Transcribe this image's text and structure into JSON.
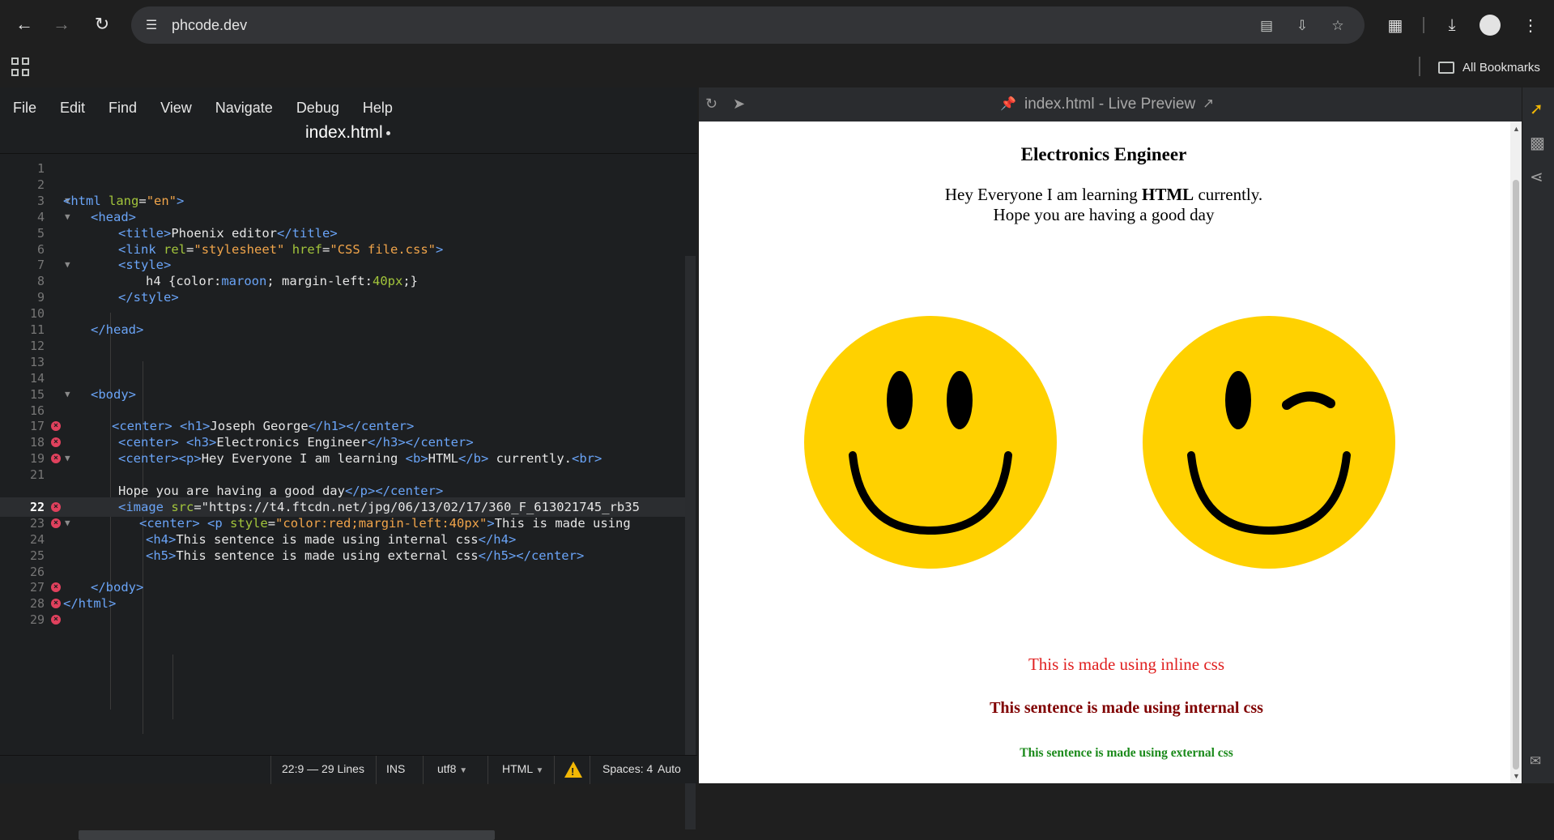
{
  "browser": {
    "url": "phcode.dev",
    "bookmarks_label": "All Bookmarks"
  },
  "editor": {
    "menu": [
      "File",
      "Edit",
      "Find",
      "View",
      "Navigate",
      "Debug",
      "Help"
    ],
    "file_title": "index.html",
    "lines": [
      {
        "n": "1",
        "text": ""
      },
      {
        "n": "2",
        "text": ""
      },
      {
        "n": "3",
        "text": "<html lang=\"en\">"
      },
      {
        "n": "4",
        "text": "<head>"
      },
      {
        "n": "5",
        "text": "<title>Phoenix editor</title>"
      },
      {
        "n": "6",
        "text": "<link rel=\"stylesheet\" href=\"CSS file.css\">"
      },
      {
        "n": "7",
        "text": "<style>"
      },
      {
        "n": "8",
        "text": "h4 {color:maroon; margin-left:40px;}"
      },
      {
        "n": "9",
        "text": "</style>"
      },
      {
        "n": "10",
        "text": ""
      },
      {
        "n": "11",
        "text": "</head>"
      },
      {
        "n": "12",
        "text": ""
      },
      {
        "n": "13",
        "text": ""
      },
      {
        "n": "14",
        "text": ""
      },
      {
        "n": "15",
        "text": "<body>"
      },
      {
        "n": "16",
        "text": ""
      },
      {
        "n": "17",
        "text": "<center> <h1>Joseph George</h1></center>"
      },
      {
        "n": "18",
        "text": "<center> <h3>Electronics Engineer</h3></center>"
      },
      {
        "n": "19",
        "text": "<center><p>Hey Everyone I am learning <b>HTML</b> currently.<br>"
      },
      {
        "n": "21",
        "text": ""
      },
      {
        "n": "",
        "text": "Hope you are having a good day</p></center>"
      },
      {
        "n": "22",
        "text": "<image src=\"https://t4.ftcdn.net/jpg/06/13/02/17/360_F_613021745_rb35"
      },
      {
        "n": "23",
        "text": "<center> <p style=\"color:red;margin-left:40px\">This is made using"
      },
      {
        "n": "24",
        "text": "<h4>This sentence is made using internal css</h4>"
      },
      {
        "n": "25",
        "text": "<h5>This sentence is made using external css</h5></center>"
      },
      {
        "n": "26",
        "text": ""
      },
      {
        "n": "27",
        "text": "</body>"
      },
      {
        "n": "28",
        "text": "</html>"
      },
      {
        "n": "29",
        "text": ""
      }
    ],
    "status": {
      "cursor": "22:9 — 29 Lines",
      "mode": "INS",
      "encoding": "utf8",
      "language": "HTML",
      "indent": "Spaces: 4",
      "auto": "Auto"
    }
  },
  "preview": {
    "title": "index.html - Live Preview",
    "h3": "Electronics Engineer",
    "p_before": "Hey Everyone I am learning ",
    "p_bold": "HTML",
    "p_after": " currently.",
    "p_line2": "Hope you are having a good day",
    "inline_css": "This is made using inline css",
    "internal_css": "This sentence is made using internal css",
    "external_css": "This sentence is made using external css",
    "smiley_color": "#FFD100"
  }
}
